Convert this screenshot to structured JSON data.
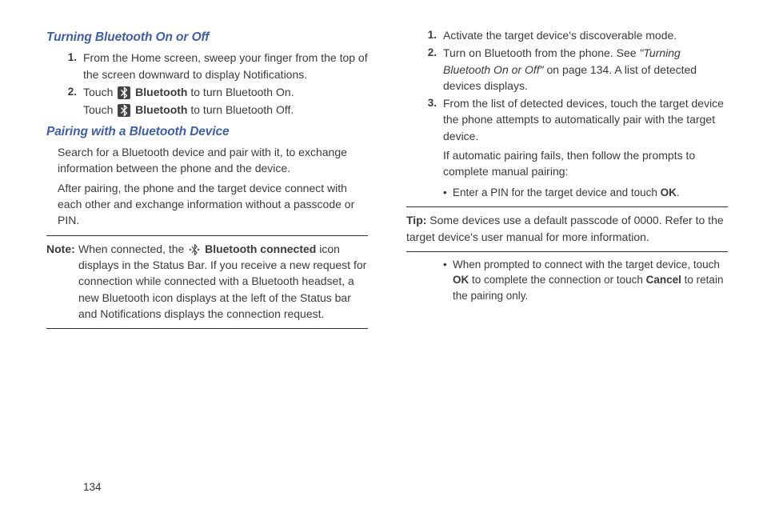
{
  "page_number": "134",
  "left": {
    "h_turning": "Turning Bluetooth On or Off",
    "turning_steps": {
      "n1": "1.",
      "t1": "From the Home screen, sweep your finger from the top of the screen downward to display Notifications.",
      "n2": "2.",
      "t2_a": "Touch ",
      "t2_b_bold": " Bluetooth",
      "t2_c": " to turn Bluetooth On.",
      "t2_line2_a": "Touch ",
      "t2_line2_b_bold": " Bluetooth",
      "t2_line2_c": " to turn Bluetooth Off."
    },
    "h_pairing": "Pairing with a Bluetooth Device",
    "pairing_p1": "Search for a Bluetooth device and pair with it, to exchange information between the phone and the device.",
    "pairing_p2": "After pairing, the phone and the target device connect with each other and exchange information without a passcode or PIN.",
    "note_label": "Note:",
    "note_a": " When connected, the ",
    "note_b_bold": " Bluetooth connected",
    "note_c": " icon displays in the Status Bar. If you receive a new request for connection while connected with a Bluetooth headset, a new Bluetooth icon displays at the left of the Status bar and Notifications displays the connection request."
  },
  "right": {
    "steps": {
      "n1": "1.",
      "t1": "Activate the target device's discoverable mode.",
      "n2": "2.",
      "t2_a": "Turn on Bluetooth from the phone. See ",
      "t2_ref": "\"Turning Bluetooth On or Off\"",
      "t2_b": " on page 134. A list of detected devices displays.",
      "n3": "3.",
      "t3_p1": "From the list of detected devices, touch the target device the phone attempts to automatically pair with the target device.",
      "t3_p2": "If automatic pairing fails, then follow the prompts to complete manual pairing:"
    },
    "bullet1_a": "Enter a PIN for the target device and touch ",
    "bullet1_b_bold": "OK",
    "bullet1_c": ".",
    "tip_label": "Tip:",
    "tip_text": " Some devices use a default passcode of 0000. Refer to the target device's user manual for more information.",
    "bullet2_a": "When prompted to connect with the target device, touch ",
    "bullet2_b_bold": "OK",
    "bullet2_c": " to complete the connection or touch ",
    "bullet2_d_bold": "Cancel",
    "bullet2_e": " to retain the pairing only."
  }
}
